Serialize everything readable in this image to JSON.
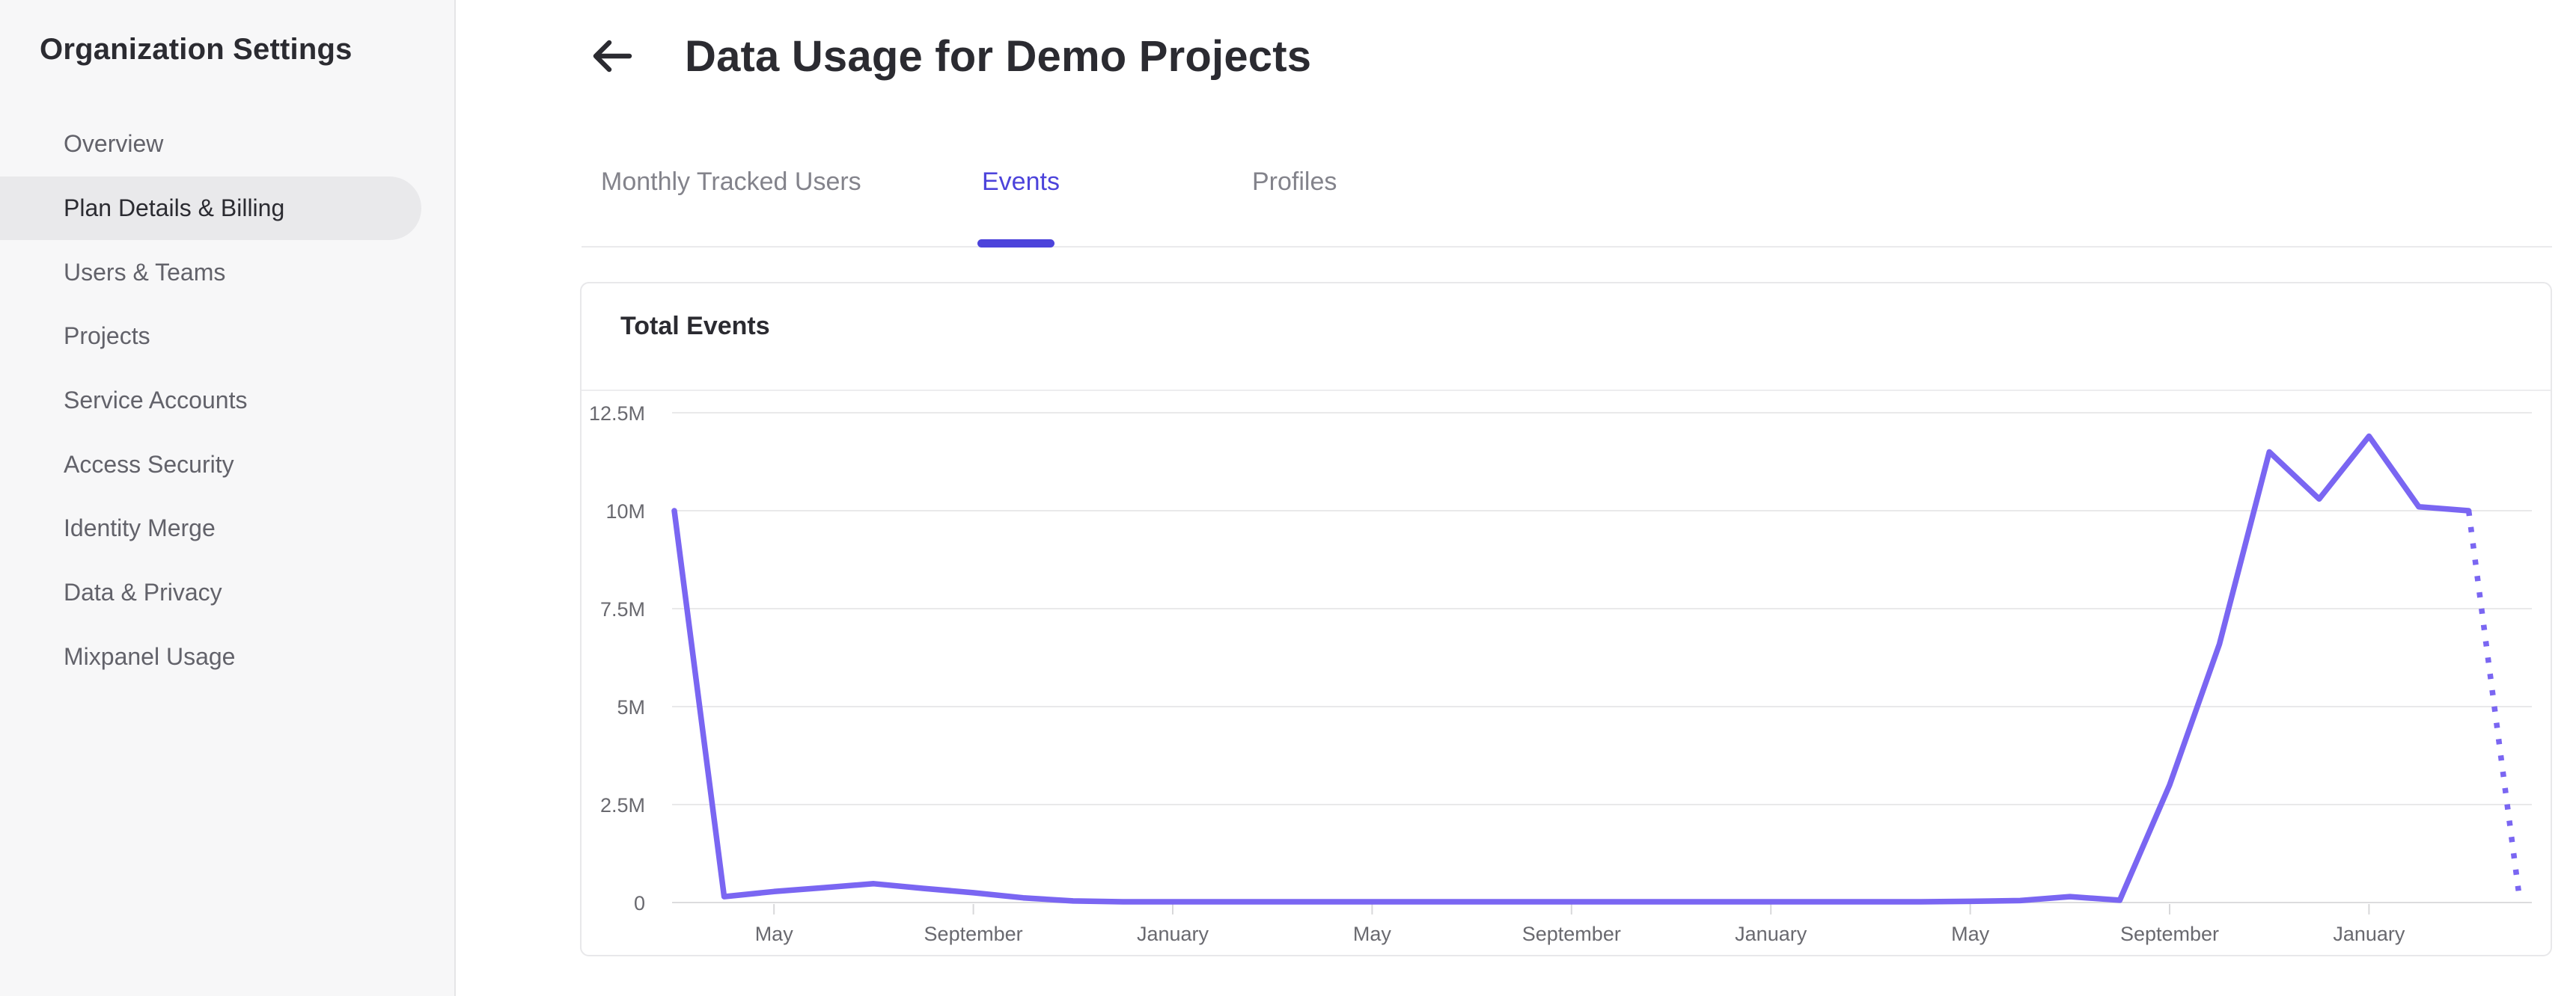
{
  "sidebar": {
    "title": "Organization Settings",
    "items": [
      {
        "label": "Overview",
        "active": false
      },
      {
        "label": "Plan Details & Billing",
        "active": true
      },
      {
        "label": "Users & Teams",
        "active": false
      },
      {
        "label": "Projects",
        "active": false
      },
      {
        "label": "Service Accounts",
        "active": false
      },
      {
        "label": "Access Security",
        "active": false
      },
      {
        "label": "Identity Merge",
        "active": false
      },
      {
        "label": "Data & Privacy",
        "active": false
      },
      {
        "label": "Mixpanel Usage",
        "active": false
      }
    ]
  },
  "header": {
    "title": "Data Usage for Demo Projects",
    "back_icon": "left-arrow-icon"
  },
  "tabs": {
    "items": [
      {
        "label": "Monthly Tracked Users",
        "active": false
      },
      {
        "label": "Events",
        "active": true
      },
      {
        "label": "Profiles",
        "active": false
      }
    ],
    "accent_color": "#4c43db"
  },
  "card": {
    "title": "Total Events"
  },
  "chart_data": {
    "type": "line",
    "title": "Total Events",
    "x_unit": "month",
    "values_unit": "millions of events",
    "ylim_millions": [
      0,
      12.5
    ],
    "y_tick_labels": [
      "12.5M",
      "10M",
      "7.5M",
      "5M",
      "2.5M",
      "0"
    ],
    "y_tick_values_millions": [
      12.5,
      10,
      7.5,
      5,
      2.5,
      0
    ],
    "x_tick_labels": [
      "May",
      "September",
      "January",
      "May",
      "September",
      "January",
      "May",
      "September",
      "January"
    ],
    "x_tick_point_indices": [
      2,
      6,
      10,
      14,
      18,
      22,
      26,
      30,
      34
    ],
    "grid": "horizontal",
    "legend": "none",
    "line_color": "#7a66f2",
    "axis_text_color": "#69696f",
    "values_millions": [
      10.0,
      0.15,
      0.28,
      0.38,
      0.48,
      0.36,
      0.25,
      0.12,
      0.04,
      0.02,
      0.02,
      0.02,
      0.02,
      0.02,
      0.02,
      0.02,
      0.02,
      0.02,
      0.02,
      0.02,
      0.02,
      0.02,
      0.02,
      0.02,
      0.02,
      0.02,
      0.03,
      0.05,
      0.15,
      0.06,
      3.0,
      6.6,
      11.5,
      10.3,
      11.9,
      10.1,
      10.0,
      0.3
    ],
    "dotted_from_index": 36
  }
}
